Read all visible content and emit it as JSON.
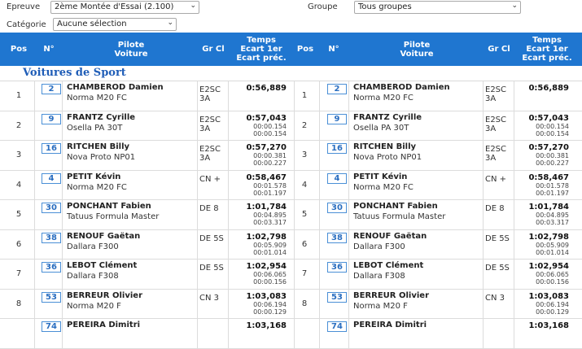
{
  "filters": {
    "epreuve_label": "Epreuve",
    "epreuve_value": "2ème Montée d'Essai (2.100)",
    "groupe_label": "Groupe",
    "groupe_value": "Tous groupes",
    "categorie_label": "Catégorie",
    "categorie_value": "Aucune sélection"
  },
  "table_header": {
    "pos": "Pos",
    "num": "N°",
    "pilote": "Pilote",
    "voiture": "Voiture",
    "grcl": "Gr Cl",
    "temps": "Temps",
    "ecart1": "Ecart 1er",
    "ecartprec": "Ecart préc."
  },
  "section_title": "Voitures de Sport",
  "left_rows": [
    {
      "pos": "1",
      "num": "2",
      "pilote": "CHAMBEROD Damien",
      "voiture": "Norma M20 FC",
      "gr": "E2SC",
      "cl": "3A",
      "temps": "0:56,889",
      "ecart1": "",
      "ecartprec": ""
    },
    {
      "pos": "2",
      "num": "9",
      "pilote": "FRANTZ Cyrille",
      "voiture": "Osella PA 30T",
      "gr": "E2SC",
      "cl": "3A",
      "temps": "0:57,043",
      "ecart1": "00:00.154",
      "ecartprec": "00:00.154"
    },
    {
      "pos": "3",
      "num": "16",
      "pilote": "RITCHEN Billy",
      "voiture": "Nova Proto NP01",
      "gr": "E2SC",
      "cl": "3A",
      "temps": "0:57,270",
      "ecart1": "00:00.381",
      "ecartprec": "00:00.227"
    },
    {
      "pos": "4",
      "num": "4",
      "pilote": "PETIT Kévin",
      "voiture": "Norma M20 FC",
      "gr": "CN +",
      "cl": "",
      "temps": "0:58,467",
      "ecart1": "00:01.578",
      "ecartprec": "00:01.197"
    },
    {
      "pos": "5",
      "num": "30",
      "pilote": "PONCHANT Fabien",
      "voiture": "Tatuus Formula Master",
      "gr": "DE 8",
      "cl": "",
      "temps": "1:01,784",
      "ecart1": "00:04.895",
      "ecartprec": "00:03.317"
    },
    {
      "pos": "6",
      "num": "38",
      "pilote": "RENOUF Gaëtan",
      "voiture": "Dallara F300",
      "gr": "DE 5S",
      "cl": "",
      "temps": "1:02,798",
      "ecart1": "00:05.909",
      "ecartprec": "00:01.014"
    },
    {
      "pos": "7",
      "num": "36",
      "pilote": "LEBOT Clément",
      "voiture": "Dallara F308",
      "gr": "DE 5S",
      "cl": "",
      "temps": "1:02,954",
      "ecart1": "00:06.065",
      "ecartprec": "00:00.156"
    },
    {
      "pos": "8",
      "num": "53",
      "pilote": "BERREUR Olivier",
      "voiture": "Norma M20 F",
      "gr": "CN 3",
      "cl": "",
      "temps": "1:03,083",
      "ecart1": "00:06.194",
      "ecartprec": "00:00.129"
    },
    {
      "pos": "",
      "num": "74",
      "pilote": "PEREIRA Dimitri",
      "voiture": "",
      "gr": "",
      "cl": "",
      "temps": "1:03,168",
      "ecart1": "",
      "ecartprec": ""
    }
  ],
  "right_rows": [
    {
      "pos": "1",
      "num": "2",
      "pilote": "CHAMBEROD Damien",
      "voiture": "Norma M20 FC",
      "gr": "E2SC",
      "cl": "3A",
      "temps": "0:56,889",
      "ecart1": "",
      "ecartprec": ""
    },
    {
      "pos": "2",
      "num": "9",
      "pilote": "FRANTZ Cyrille",
      "voiture": "Osella PA 30T",
      "gr": "E2SC",
      "cl": "3A",
      "temps": "0:57,043",
      "ecart1": "00:00.154",
      "ecartprec": "00:00.154"
    },
    {
      "pos": "3",
      "num": "16",
      "pilote": "RITCHEN Billy",
      "voiture": "Nova Proto NP01",
      "gr": "E2SC",
      "cl": "3A",
      "temps": "0:57,270",
      "ecart1": "00:00.381",
      "ecartprec": "00:00.227"
    },
    {
      "pos": "4",
      "num": "4",
      "pilote": "PETIT Kévin",
      "voiture": "Norma M20 FC",
      "gr": "CN +",
      "cl": "",
      "temps": "0:58,467",
      "ecart1": "00:01.578",
      "ecartprec": "00:01.197"
    },
    {
      "pos": "5",
      "num": "30",
      "pilote": "PONCHANT Fabien",
      "voiture": "Tatuus Formula Master",
      "gr": "DE 8",
      "cl": "",
      "temps": "1:01,784",
      "ecart1": "00:04.895",
      "ecartprec": "00:03.317"
    },
    {
      "pos": "6",
      "num": "38",
      "pilote": "RENOUF Gaëtan",
      "voiture": "Dallara F300",
      "gr": "DE 5S",
      "cl": "",
      "temps": "1:02,798",
      "ecart1": "00:05.909",
      "ecartprec": "00:01.014"
    },
    {
      "pos": "7",
      "num": "36",
      "pilote": "LEBOT Clément",
      "voiture": "Dallara F308",
      "gr": "DE 5S",
      "cl": "",
      "temps": "1:02,954",
      "ecart1": "00:06.065",
      "ecartprec": "00:00.156"
    },
    {
      "pos": "8",
      "num": "53",
      "pilote": "BERREUR Olivier",
      "voiture": "Norma M20 F",
      "gr": "CN 3",
      "cl": "",
      "temps": "1:03,083",
      "ecart1": "00:06.194",
      "ecartprec": "00:00.129"
    },
    {
      "pos": "",
      "num": "74",
      "pilote": "PEREIRA Dimitri",
      "voiture": "",
      "gr": "",
      "cl": "",
      "temps": "1:03,168",
      "ecart1": "",
      "ecartprec": ""
    }
  ],
  "colors": {
    "header_bg": "#1f76d0",
    "section_title": "#1f5db7",
    "number_box": "#4a8fd6"
  },
  "icons": {
    "dropdown": "chevron-down-icon"
  }
}
